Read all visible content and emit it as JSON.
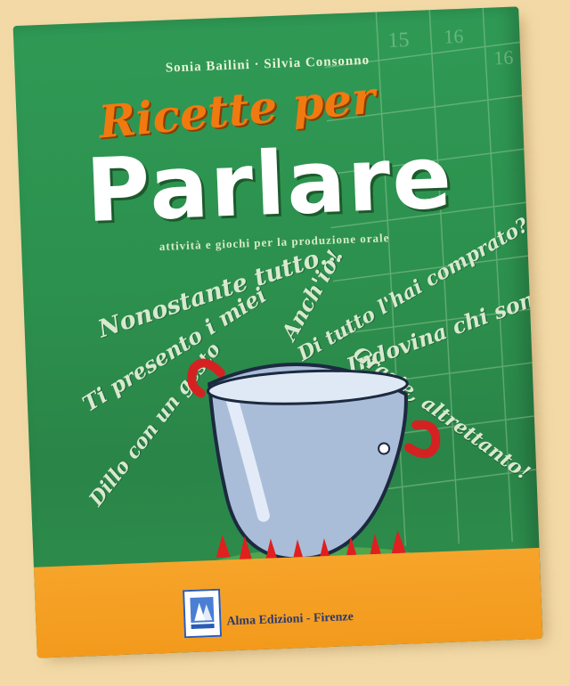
{
  "book": {
    "authors": "Sonia Bailini · Silvia Consonno",
    "title_line1": "Ricette per",
    "title_line2": "Parlare",
    "subtitle": "attività e giochi per la produzione orale",
    "publisher": "Alma Edizioni - Firenze"
  },
  "phrases": [
    "Nonostante tutto...",
    "Ti presento i miei",
    "Dillo con un gesto",
    "Anch'io!",
    "Di tutto l'hai comprato?",
    "Indovina chi sono",
    "Grazie, altrettanto!"
  ],
  "calendar_numbers": [
    "15",
    "16",
    "16"
  ],
  "colors": {
    "cover_green": "#2c8f4d",
    "title_orange": "#f07a10",
    "footer_orange": "#f39a1c",
    "background": "#f2d9a6"
  }
}
